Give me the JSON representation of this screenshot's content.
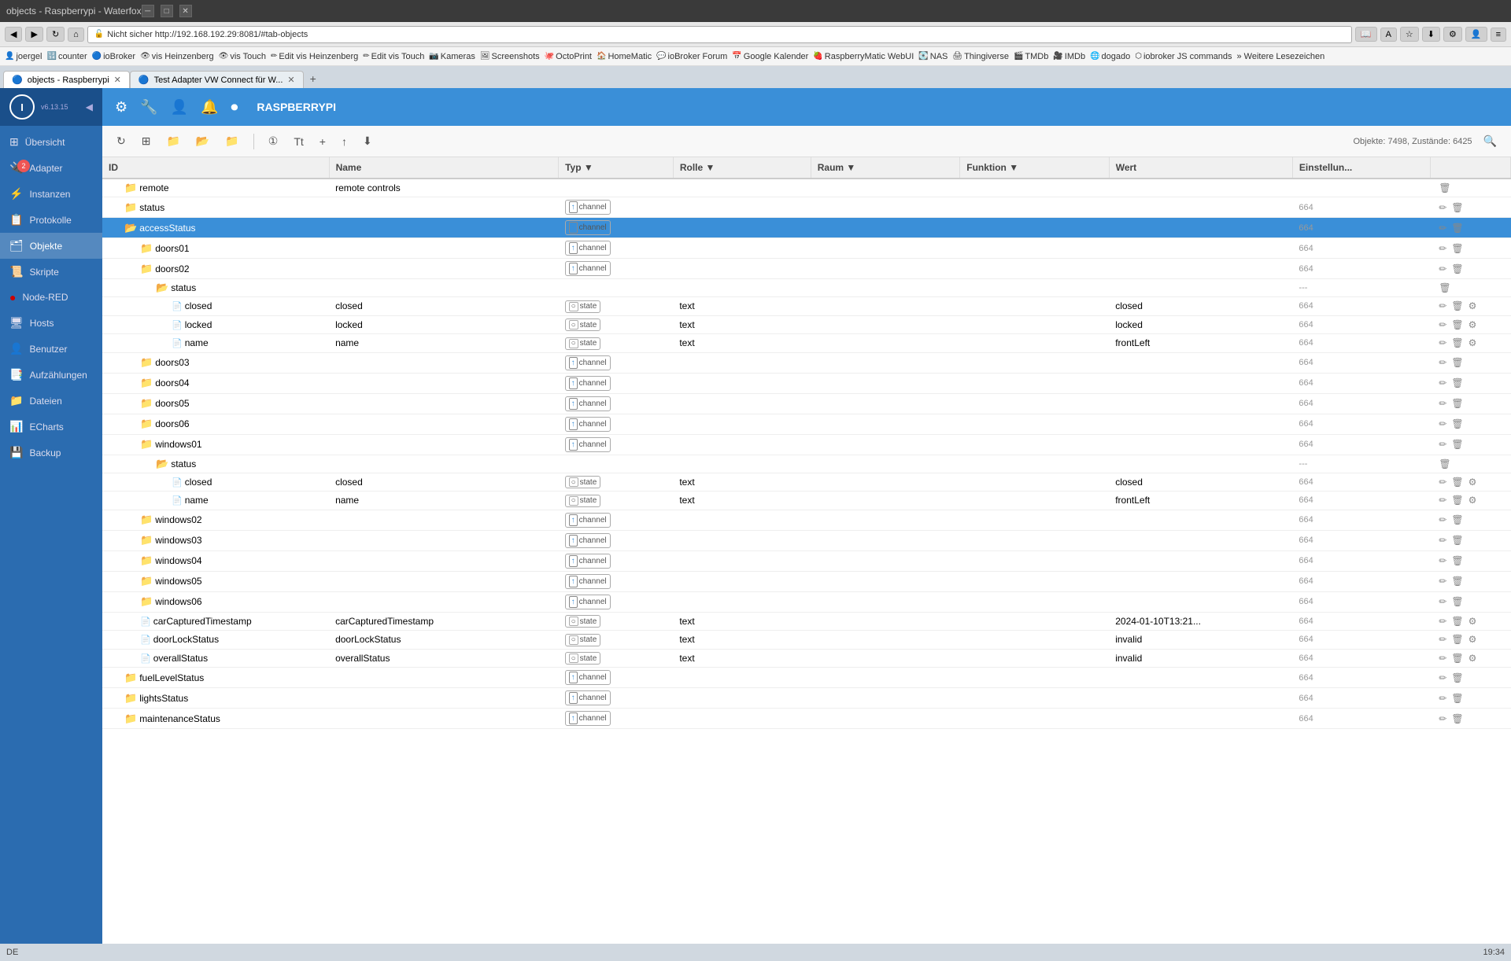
{
  "browser": {
    "title": "objects - Raspberrypi - Waterfox",
    "nav": {
      "back": "◀",
      "forward": "▶",
      "reload": "↻",
      "home": "⌂"
    },
    "address": "http://192.168.192.29:8081/#tab-objects",
    "security_text": "Nicht sicher",
    "tabs": [
      {
        "label": "objects - Raspberrypi",
        "active": true
      },
      {
        "label": "Test Adapter VW Connect für W...",
        "active": false
      }
    ],
    "bookmarks": [
      "joergel",
      "counter",
      "ioBroker",
      "vis Heinzenberg",
      "vis Touch",
      "Edit vis Heinzenberg",
      "Edit vis Touch",
      "Kameras",
      "Screenshots",
      "OctoPrint",
      "HomeMatic",
      "ioBroker Forum",
      "Google Kalender",
      "RaspberryMatic WebUI",
      "NAS",
      "Thingiverse",
      "TMDb",
      "IMDb",
      "dogado",
      "iobroker JS commands",
      "Weitere Lesezeichen"
    ]
  },
  "topbar": {
    "title": "RASPBERRYPI",
    "tools": [
      "⚙",
      "🔧",
      "👤",
      "🔔",
      "⏸",
      "⏺"
    ]
  },
  "sidebar": {
    "logo_text": "I",
    "version": "v6.13.15",
    "items": [
      {
        "icon": "⊞",
        "label": "Übersicht",
        "active": false
      },
      {
        "icon": "🔌",
        "label": "Adapter",
        "active": false,
        "badge": "2"
      },
      {
        "icon": "⚡",
        "label": "Instanzen",
        "active": false
      },
      {
        "icon": "📋",
        "label": "Protokolle",
        "active": false
      },
      {
        "icon": "🗂",
        "label": "Objekte",
        "active": true
      },
      {
        "icon": "📜",
        "label": "Skripte",
        "active": false
      },
      {
        "icon": "🔴",
        "label": "Node-RED",
        "active": false
      },
      {
        "icon": "🖥",
        "label": "Hosts",
        "active": false
      },
      {
        "icon": "👤",
        "label": "Benutzer",
        "active": false
      },
      {
        "icon": "📑",
        "label": "Aufzählungen",
        "active": false
      },
      {
        "icon": "📁",
        "label": "Dateien",
        "active": false
      },
      {
        "icon": "📊",
        "label": "ECharts",
        "active": false
      },
      {
        "icon": "💾",
        "label": "Backup",
        "active": false
      }
    ]
  },
  "toolbar": {
    "obj_count": "Objekte: 7498, Zustände: 6425",
    "buttons": [
      "↻",
      "⊞",
      "📁",
      "📂",
      "📁",
      "①",
      "Tt",
      "+",
      "↑",
      "⬇"
    ]
  },
  "table": {
    "columns": [
      "ID",
      "Name",
      "Typ",
      "Rolle",
      "Raum",
      "Funktion",
      "Wert",
      "Einstellun..."
    ],
    "rows": [
      {
        "indent": 2,
        "icon": "folder",
        "id": "remote",
        "name": "remote controls",
        "typ": "",
        "role": "",
        "room": "",
        "func": "",
        "val": "",
        "num": "",
        "selected": false
      },
      {
        "indent": 2,
        "icon": "folder",
        "id": "status",
        "name": "",
        "typ": "channel",
        "role": "",
        "room": "",
        "func": "",
        "val": "",
        "num": "664",
        "selected": false
      },
      {
        "indent": 2,
        "icon": "folder-open",
        "id": "accessStatus",
        "name": "",
        "typ": "channel",
        "role": "",
        "room": "",
        "func": "",
        "val": "",
        "num": "664",
        "selected": true
      },
      {
        "indent": 3,
        "icon": "folder",
        "id": "doors01",
        "name": "",
        "typ": "channel",
        "role": "",
        "room": "",
        "func": "",
        "val": "",
        "num": "664",
        "selected": false
      },
      {
        "indent": 3,
        "icon": "folder",
        "id": "doors02",
        "name": "",
        "typ": "channel",
        "role": "",
        "room": "",
        "func": "",
        "val": "",
        "num": "664",
        "selected": false
      },
      {
        "indent": 4,
        "icon": "folder-open",
        "id": "status",
        "name": "",
        "typ": "",
        "role": "",
        "room": "",
        "func": "",
        "val": "",
        "num": "---",
        "selected": false
      },
      {
        "indent": 5,
        "icon": "file",
        "id": "closed",
        "name": "closed",
        "typ": "state",
        "role": "text",
        "room": "",
        "func": "",
        "val": "closed",
        "num": "664",
        "selected": false
      },
      {
        "indent": 5,
        "icon": "file",
        "id": "locked",
        "name": "locked",
        "typ": "state",
        "role": "text",
        "room": "",
        "func": "",
        "val": "locked",
        "num": "664",
        "selected": false
      },
      {
        "indent": 5,
        "icon": "file",
        "id": "name",
        "name": "name",
        "typ": "state",
        "role": "text",
        "room": "",
        "func": "",
        "val": "frontLeft",
        "num": "664",
        "selected": false
      },
      {
        "indent": 3,
        "icon": "folder",
        "id": "doors03",
        "name": "",
        "typ": "channel",
        "role": "",
        "room": "",
        "func": "",
        "val": "",
        "num": "664",
        "selected": false
      },
      {
        "indent": 3,
        "icon": "folder",
        "id": "doors04",
        "name": "",
        "typ": "channel",
        "role": "",
        "room": "",
        "func": "",
        "val": "",
        "num": "664",
        "selected": false
      },
      {
        "indent": 3,
        "icon": "folder",
        "id": "doors05",
        "name": "",
        "typ": "channel",
        "role": "",
        "room": "",
        "func": "",
        "val": "",
        "num": "664",
        "selected": false
      },
      {
        "indent": 3,
        "icon": "folder",
        "id": "doors06",
        "name": "",
        "typ": "channel",
        "role": "",
        "room": "",
        "func": "",
        "val": "",
        "num": "664",
        "selected": false
      },
      {
        "indent": 3,
        "icon": "folder",
        "id": "windows01",
        "name": "",
        "typ": "channel",
        "role": "",
        "room": "",
        "func": "",
        "val": "",
        "num": "664",
        "selected": false
      },
      {
        "indent": 4,
        "icon": "folder-open",
        "id": "status",
        "name": "",
        "typ": "",
        "role": "",
        "room": "",
        "func": "",
        "val": "",
        "num": "---",
        "selected": false
      },
      {
        "indent": 5,
        "icon": "file",
        "id": "closed",
        "name": "closed",
        "typ": "state",
        "role": "text",
        "room": "",
        "func": "",
        "val": "closed",
        "num": "664",
        "selected": false
      },
      {
        "indent": 5,
        "icon": "file",
        "id": "name",
        "name": "name",
        "typ": "state",
        "role": "text",
        "room": "",
        "func": "",
        "val": "frontLeft",
        "num": "664",
        "selected": false
      },
      {
        "indent": 3,
        "icon": "folder",
        "id": "windows02",
        "name": "",
        "typ": "channel",
        "role": "",
        "room": "",
        "func": "",
        "val": "",
        "num": "664",
        "selected": false
      },
      {
        "indent": 3,
        "icon": "folder",
        "id": "windows03",
        "name": "",
        "typ": "channel",
        "role": "",
        "room": "",
        "func": "",
        "val": "",
        "num": "664",
        "selected": false
      },
      {
        "indent": 3,
        "icon": "folder",
        "id": "windows04",
        "name": "",
        "typ": "channel",
        "role": "",
        "room": "",
        "func": "",
        "val": "",
        "num": "664",
        "selected": false
      },
      {
        "indent": 3,
        "icon": "folder",
        "id": "windows05",
        "name": "",
        "typ": "channel",
        "role": "",
        "room": "",
        "func": "",
        "val": "",
        "num": "664",
        "selected": false
      },
      {
        "indent": 3,
        "icon": "folder",
        "id": "windows06",
        "name": "",
        "typ": "channel",
        "role": "",
        "room": "",
        "func": "",
        "val": "",
        "num": "664",
        "selected": false
      },
      {
        "indent": 3,
        "icon": "file",
        "id": "carCapturedTimestamp",
        "name": "carCapturedTimestamp",
        "typ": "state",
        "role": "text",
        "room": "",
        "func": "",
        "val": "2024-01-10T13:21...",
        "num": "664",
        "selected": false
      },
      {
        "indent": 3,
        "icon": "file",
        "id": "doorLockStatus",
        "name": "doorLockStatus",
        "typ": "state",
        "role": "text",
        "room": "",
        "func": "",
        "val": "invalid",
        "num": "664",
        "selected": false
      },
      {
        "indent": 3,
        "icon": "file",
        "id": "overallStatus",
        "name": "overallStatus",
        "typ": "state",
        "role": "text",
        "room": "",
        "func": "",
        "val": "invalid",
        "num": "664",
        "selected": false
      },
      {
        "indent": 2,
        "icon": "folder",
        "id": "fuelLevelStatus",
        "name": "",
        "typ": "channel",
        "role": "",
        "room": "",
        "func": "",
        "val": "",
        "num": "664",
        "selected": false
      },
      {
        "indent": 2,
        "icon": "folder",
        "id": "lightsStatus",
        "name": "",
        "typ": "channel",
        "role": "",
        "room": "",
        "func": "",
        "val": "",
        "num": "664",
        "selected": false
      },
      {
        "indent": 2,
        "icon": "folder",
        "id": "maintenanceStatus",
        "name": "",
        "typ": "channel",
        "role": "",
        "room": "",
        "func": "",
        "val": "",
        "num": "664",
        "selected": false
      }
    ]
  },
  "statusbar": {
    "language": "DE",
    "time": "19:34"
  }
}
